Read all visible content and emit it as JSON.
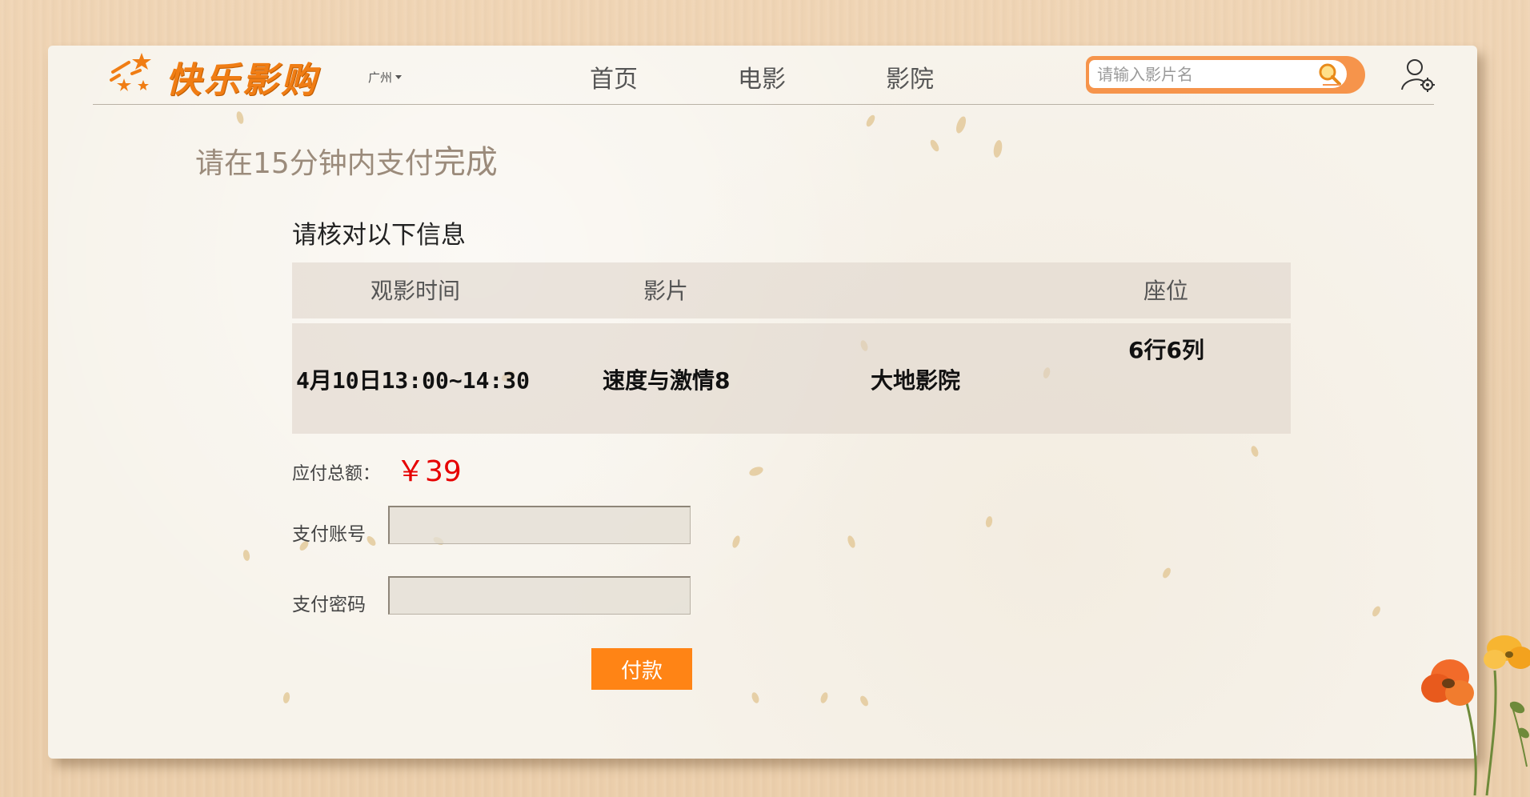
{
  "app": {
    "logo_text": "快乐影购",
    "city": "广州"
  },
  "nav": {
    "items": [
      {
        "label": "首页"
      },
      {
        "label": "电影"
      },
      {
        "label": "影院"
      }
    ]
  },
  "search": {
    "placeholder": "请输入影片名"
  },
  "payment": {
    "title_prefix": "请在15分钟内支付",
    "title_suffix": "完成",
    "section_title": "请核对以下信息",
    "table": {
      "headers": {
        "time": "观影时间",
        "movie": "影片",
        "seat": "座位"
      },
      "row": {
        "time": "4月10日13:00~14:30",
        "movie": "速度与激情8",
        "cinema": "大地影院",
        "seat": "6行6列"
      }
    },
    "total_label": "应付总额：",
    "total_value": "￥39",
    "account_label": "支付账号",
    "account_value": "",
    "password_label": "支付密码",
    "password_value": "",
    "pay_button": "付款"
  },
  "colors": {
    "accent": "#ff8415",
    "logo": "#f07d14",
    "price": "#e60000",
    "background": "#ecd0ae",
    "paper": "#f7f3eb"
  },
  "icons": {
    "logo": "stars-logo-icon",
    "city_caret": "caret-down-icon",
    "search": "magnifier-icon",
    "user": "user-settings-icon",
    "decoration": "poppy-flower-icon"
  }
}
